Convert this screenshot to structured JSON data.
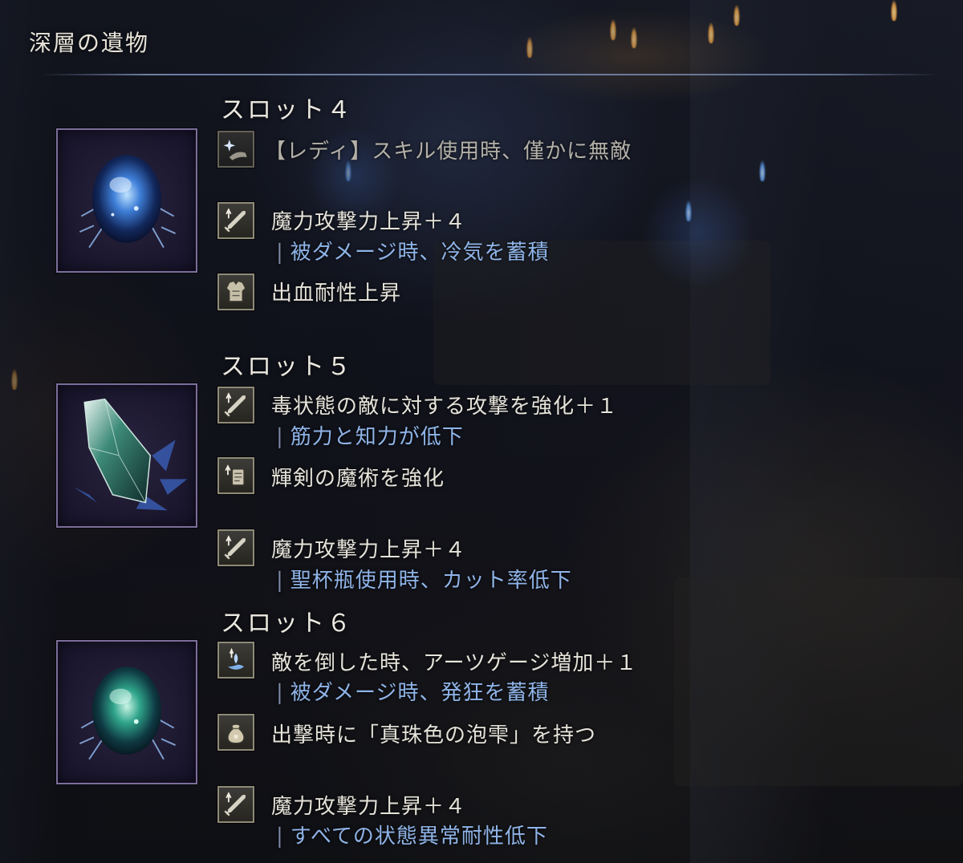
{
  "page_title": "深層の遺物",
  "slots": [
    {
      "heading": "スロット４",
      "relic_icon": "blue-coral-orb-relic",
      "effects": [
        {
          "icon": "sparkle-hand-icon",
          "main": "【レディ】スキル使用時、僅かに無敵",
          "sub": ""
        },
        {
          "icon": "sword-up-icon",
          "main": "魔力攻撃力上昇＋４",
          "sub": "被ダメージ時、冷気を蓄積"
        },
        {
          "icon": "armor-icon",
          "main": "出血耐性上昇",
          "sub": ""
        }
      ]
    },
    {
      "heading": "スロット５",
      "relic_icon": "green-crystal-relic",
      "effects": [
        {
          "icon": "sword-up-icon",
          "main": "毒状態の敵に対する攻撃を強化＋１",
          "sub": "筋力と知力が低下"
        },
        {
          "icon": "scroll-up-icon",
          "main": "輝剣の魔術を強化",
          "sub": ""
        },
        {
          "icon": "sword-up-icon",
          "main": "魔力攻撃力上昇＋４",
          "sub": "聖杯瓶使用時、カット率低下"
        }
      ]
    },
    {
      "heading": "スロット６",
      "relic_icon": "green-coral-orb-relic",
      "effects": [
        {
          "icon": "arts-swirl-icon",
          "main": "敵を倒した時、アーツゲージ増加＋１",
          "sub": "被ダメージ時、発狂を蓄積"
        },
        {
          "icon": "pouch-icon",
          "main": "出撃時に「真珠色の泡雫」を持つ",
          "sub": ""
        },
        {
          "icon": "sword-up-icon",
          "main": "魔力攻撃力上昇＋４",
          "sub": "すべての状態異常耐性低下"
        }
      ]
    }
  ],
  "colors": {
    "heading": "#ece9e0",
    "effect_text": "#e6e3da",
    "sub_effect_text": "#8fb4e8",
    "frame_border": "#7c6e9a"
  }
}
